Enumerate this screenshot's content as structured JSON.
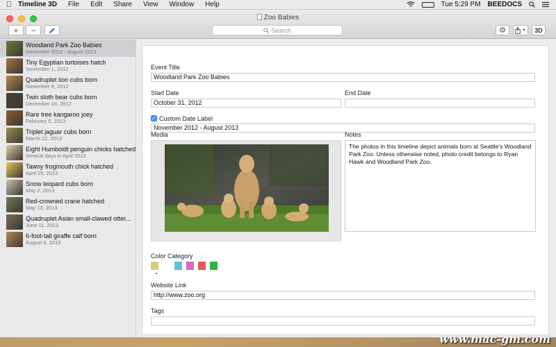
{
  "menubar": {
    "app_name": "Timeline 3D",
    "menus": [
      "File",
      "Edit",
      "Share",
      "View",
      "Window",
      "Help"
    ],
    "battery_label": "",
    "clock": "Tue 5:29 PM",
    "user": "BEEDOCS"
  },
  "window": {
    "title": "Zoo Babies",
    "search_placeholder": "Search",
    "view_3d_label": "3D"
  },
  "sidebar": {
    "items": [
      {
        "title": "Woodland Park Zoo Babies",
        "date": "November 2012 - August 2013",
        "thumb_color": "#6b7a3a",
        "selected": true
      },
      {
        "title": "Tiny Egyptian tortoises hatch",
        "date": "November 1, 2012",
        "thumb_color": "#a5704a"
      },
      {
        "title": "Quadruplet lion cubs born",
        "date": "November 8, 2012",
        "thumb_color": "#b58a4c"
      },
      {
        "title": "Twin sloth bear cubs born",
        "date": "December 18, 2012",
        "thumb_color": "#4a4034"
      },
      {
        "title": "Rare tree kangaroo joey",
        "date": "February 5, 2013",
        "thumb_color": "#8c5a35"
      },
      {
        "title": "Triplet jaguar cubs born",
        "date": "March 22, 2013",
        "thumb_color": "#9a8a52"
      },
      {
        "title": "Eight Humboldt penguin chicks hatched",
        "date": "Several days in April 2013",
        "thumb_color": "#d8c9a8"
      },
      {
        "title": "Tawny frogmouth chick hatched",
        "date": "April 29, 2013",
        "thumb_color": "#e2c45a"
      },
      {
        "title": "Snow leopard cubs born",
        "date": "May 2, 2013",
        "thumb_color": "#c7c2b4"
      },
      {
        "title": "Red-crowned crane hatched",
        "date": "May 13, 2013",
        "thumb_color": "#6d7b5a"
      },
      {
        "title": "Quadruplet Asian small-clawed otter...",
        "date": "June 11, 2013",
        "thumb_color": "#7a6b55"
      },
      {
        "title": "6-foot-tall giraffe calf born",
        "date": "August 6, 2013",
        "thumb_color": "#b08b5d"
      }
    ]
  },
  "form": {
    "event_title_label": "Event Title",
    "event_title_value": "Woodland Park Zoo Babies",
    "start_date_label": "Start Date",
    "start_date_value": "October 31, 2012",
    "end_date_label": "End Date",
    "end_date_value": "",
    "custom_date_label": "Custom Date Label",
    "custom_date_checked": true,
    "custom_date_value": "November 2012 - August 2013",
    "media_label": "Media",
    "notes_label": "Notes",
    "notes_value": "The photos in this timeline depict animals born at Seattle's Woodland Park Zoo. Unless otherwise noted, photo credit belongs to Ryan Hawk and Woodland Park Zoo.",
    "color_category_label": "Color Category",
    "colors": [
      "#d8cd7a",
      "#ffffff",
      "#5fc0e0",
      "#d66ac8",
      "#e05a5a",
      "#2fb34a"
    ],
    "selected_color_index": 0,
    "website_label": "Website Link",
    "website_value": "http://www.zoo.org",
    "tags_label": "Tags",
    "tags_value": ""
  },
  "watermark": "www.mac-gm.com"
}
